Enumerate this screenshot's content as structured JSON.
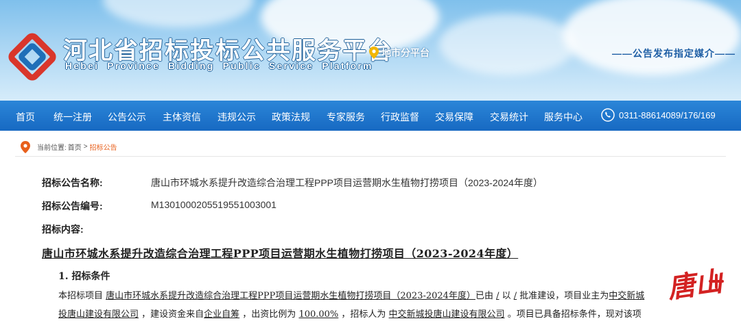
{
  "header": {
    "title": "河北省招标投标公共服务平台",
    "subtitle": "Hebei Province Bidding Public Service Platform",
    "city_link": "地市分平台",
    "slogan": "——公告发布指定媒介——"
  },
  "nav": {
    "items": [
      {
        "label": "首页"
      },
      {
        "label": "统一注册"
      },
      {
        "label": "公告公示"
      },
      {
        "label": "主体资信"
      },
      {
        "label": "违规公示"
      },
      {
        "label": "政策法规"
      },
      {
        "label": "专家服务"
      },
      {
        "label": "行政监督"
      },
      {
        "label": "交易保障"
      },
      {
        "label": "交易统计"
      },
      {
        "label": "服务中心"
      }
    ],
    "phone": "0311-88614089/176/169"
  },
  "breadcrumb": {
    "prefix": "当前位置:",
    "home": "首页",
    "sep": ">",
    "current": "招标公告"
  },
  "notice": {
    "name_label": "招标公告名称:",
    "name_value": "唐山市环城水系提升改造综合治理工程PPP项目运营期水生植物打捞项目（2023-2024年度）",
    "code_label": "招标公告编号:",
    "code_value": "M1301000205519551003001",
    "content_label": "招标内容:"
  },
  "content": {
    "title": "唐山市环城水系提升改造综合治理工程PPP项目运营期水生植物打捞项目（2023-2024年度）",
    "section1": "1. 招标条件",
    "line1": {
      "p1": "本招标项目 ",
      "u1": "唐山市环城水系提升改造综合治理工程PPP项目运营期水生植物打捞项目（2023-2024年度）",
      "p2": "已由 ",
      "u2": "/",
      "p3": " 以 ",
      "u3": "/",
      "p4": " 批准建设，项目业主为",
      "u4": "中交新城"
    },
    "line2": {
      "u1": "投唐山建设有限公司",
      "p1": " ，建设资金来自",
      "u2": "企业自筹",
      "p2": " ，出资比例为 ",
      "u3": "100.00%",
      "p3": " ，招标人为 ",
      "u4": "中交新城投唐山建设有限公司",
      "p4": " 。项目已具备招标条件，现对该项"
    }
  },
  "watermark": {
    "text": "唐山+"
  },
  "colors": {
    "nav_bg": "#1d74cc",
    "accent_orange": "#e8601c",
    "slogan_blue": "#1f5fa5",
    "logo_red": "#d9362b",
    "logo_blue": "#1f6fb8"
  }
}
